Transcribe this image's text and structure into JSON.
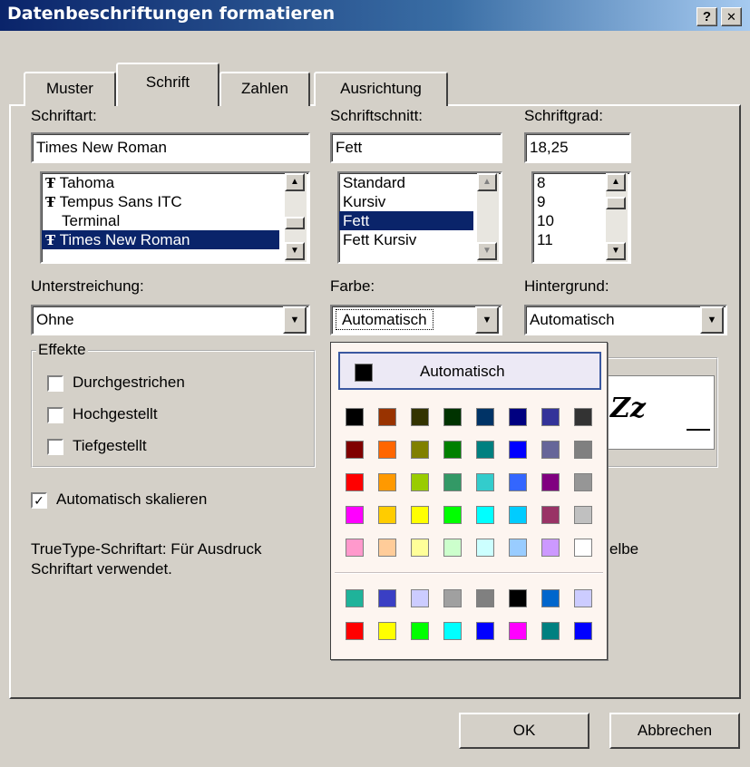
{
  "window": {
    "title": "Datenbeschriftungen formatieren",
    "help_label": "?",
    "close_label": "✕"
  },
  "tabs": [
    {
      "label": "Muster"
    },
    {
      "label": "Schrift"
    },
    {
      "label": "Zahlen"
    },
    {
      "label": "Ausrichtung"
    }
  ],
  "active_tab": "Schrift",
  "font": {
    "label": "Schriftart:",
    "value": "Times New Roman",
    "items": [
      {
        "label": "Tahoma",
        "icon": "truetype-icon"
      },
      {
        "label": "Tempus Sans ITC",
        "icon": "truetype-icon"
      },
      {
        "label": "Terminal",
        "icon": ""
      },
      {
        "label": "Times New Roman",
        "icon": "truetype-icon"
      }
    ],
    "selected": "Times New Roman"
  },
  "style": {
    "label": "Schriftschnitt:",
    "value": "Fett",
    "items": [
      "Standard",
      "Kursiv",
      "Fett",
      "Fett Kursiv"
    ],
    "selected": "Fett"
  },
  "size": {
    "label": "Schriftgrad:",
    "value": "18,25",
    "items": [
      "8",
      "9",
      "10",
      "11"
    ]
  },
  "underline": {
    "label": "Unterstreichung:",
    "value": "Ohne"
  },
  "color": {
    "label": "Farbe:",
    "value": "Automatisch"
  },
  "background": {
    "label": "Hintergrund:",
    "value": "Automatisch"
  },
  "effects": {
    "title": "Effekte",
    "items": [
      {
        "label": "Durchgestrichen",
        "checked": false
      },
      {
        "label": "Hochgestellt",
        "checked": false
      },
      {
        "label": "Tiefgestellt",
        "checked": false
      }
    ]
  },
  "autoscale": {
    "label": "Automatisch skalieren",
    "checked": true
  },
  "preview": {
    "text": "Zz"
  },
  "info_text": {
    "line1_left": "TrueType-Schriftart: Für Ausdruck",
    "line1_right": "elbe",
    "line2": "Schriftart verwendet."
  },
  "color_popup": {
    "auto_label": "Automatisch",
    "auto_color": "#000000",
    "palette": [
      [
        "#000000",
        "#993300",
        "#333300",
        "#003300",
        "#003366",
        "#000080",
        "#333399",
        "#333333"
      ],
      [
        "#800000",
        "#ff6600",
        "#808000",
        "#008000",
        "#008080",
        "#0000ff",
        "#666699",
        "#808080"
      ],
      [
        "#ff0000",
        "#ff9900",
        "#99cc00",
        "#339966",
        "#33cccc",
        "#3366ff",
        "#800080",
        "#969696"
      ],
      [
        "#ff00ff",
        "#ffcc00",
        "#ffff00",
        "#00ff00",
        "#00ffff",
        "#00ccff",
        "#993366",
        "#c0c0c0"
      ],
      [
        "#ff99cc",
        "#ffcc99",
        "#ffff99",
        "#ccffcc",
        "#ccffff",
        "#99ccff",
        "#cc99ff",
        "#ffffff"
      ]
    ],
    "extra": [
      [
        "#1fb39a",
        "#3a3fc4",
        "#ccccff",
        "#a0a0a0",
        "#808080",
        "#000000",
        "#0066cc",
        "#ccccff"
      ],
      [
        "#ff0000",
        "#ffff00",
        "#00ff00",
        "#00ffff",
        "#0000ff",
        "#ff00ff",
        "#008080",
        "#0000ff"
      ]
    ]
  },
  "buttons": {
    "ok": "OK",
    "cancel": "Abbrechen"
  }
}
